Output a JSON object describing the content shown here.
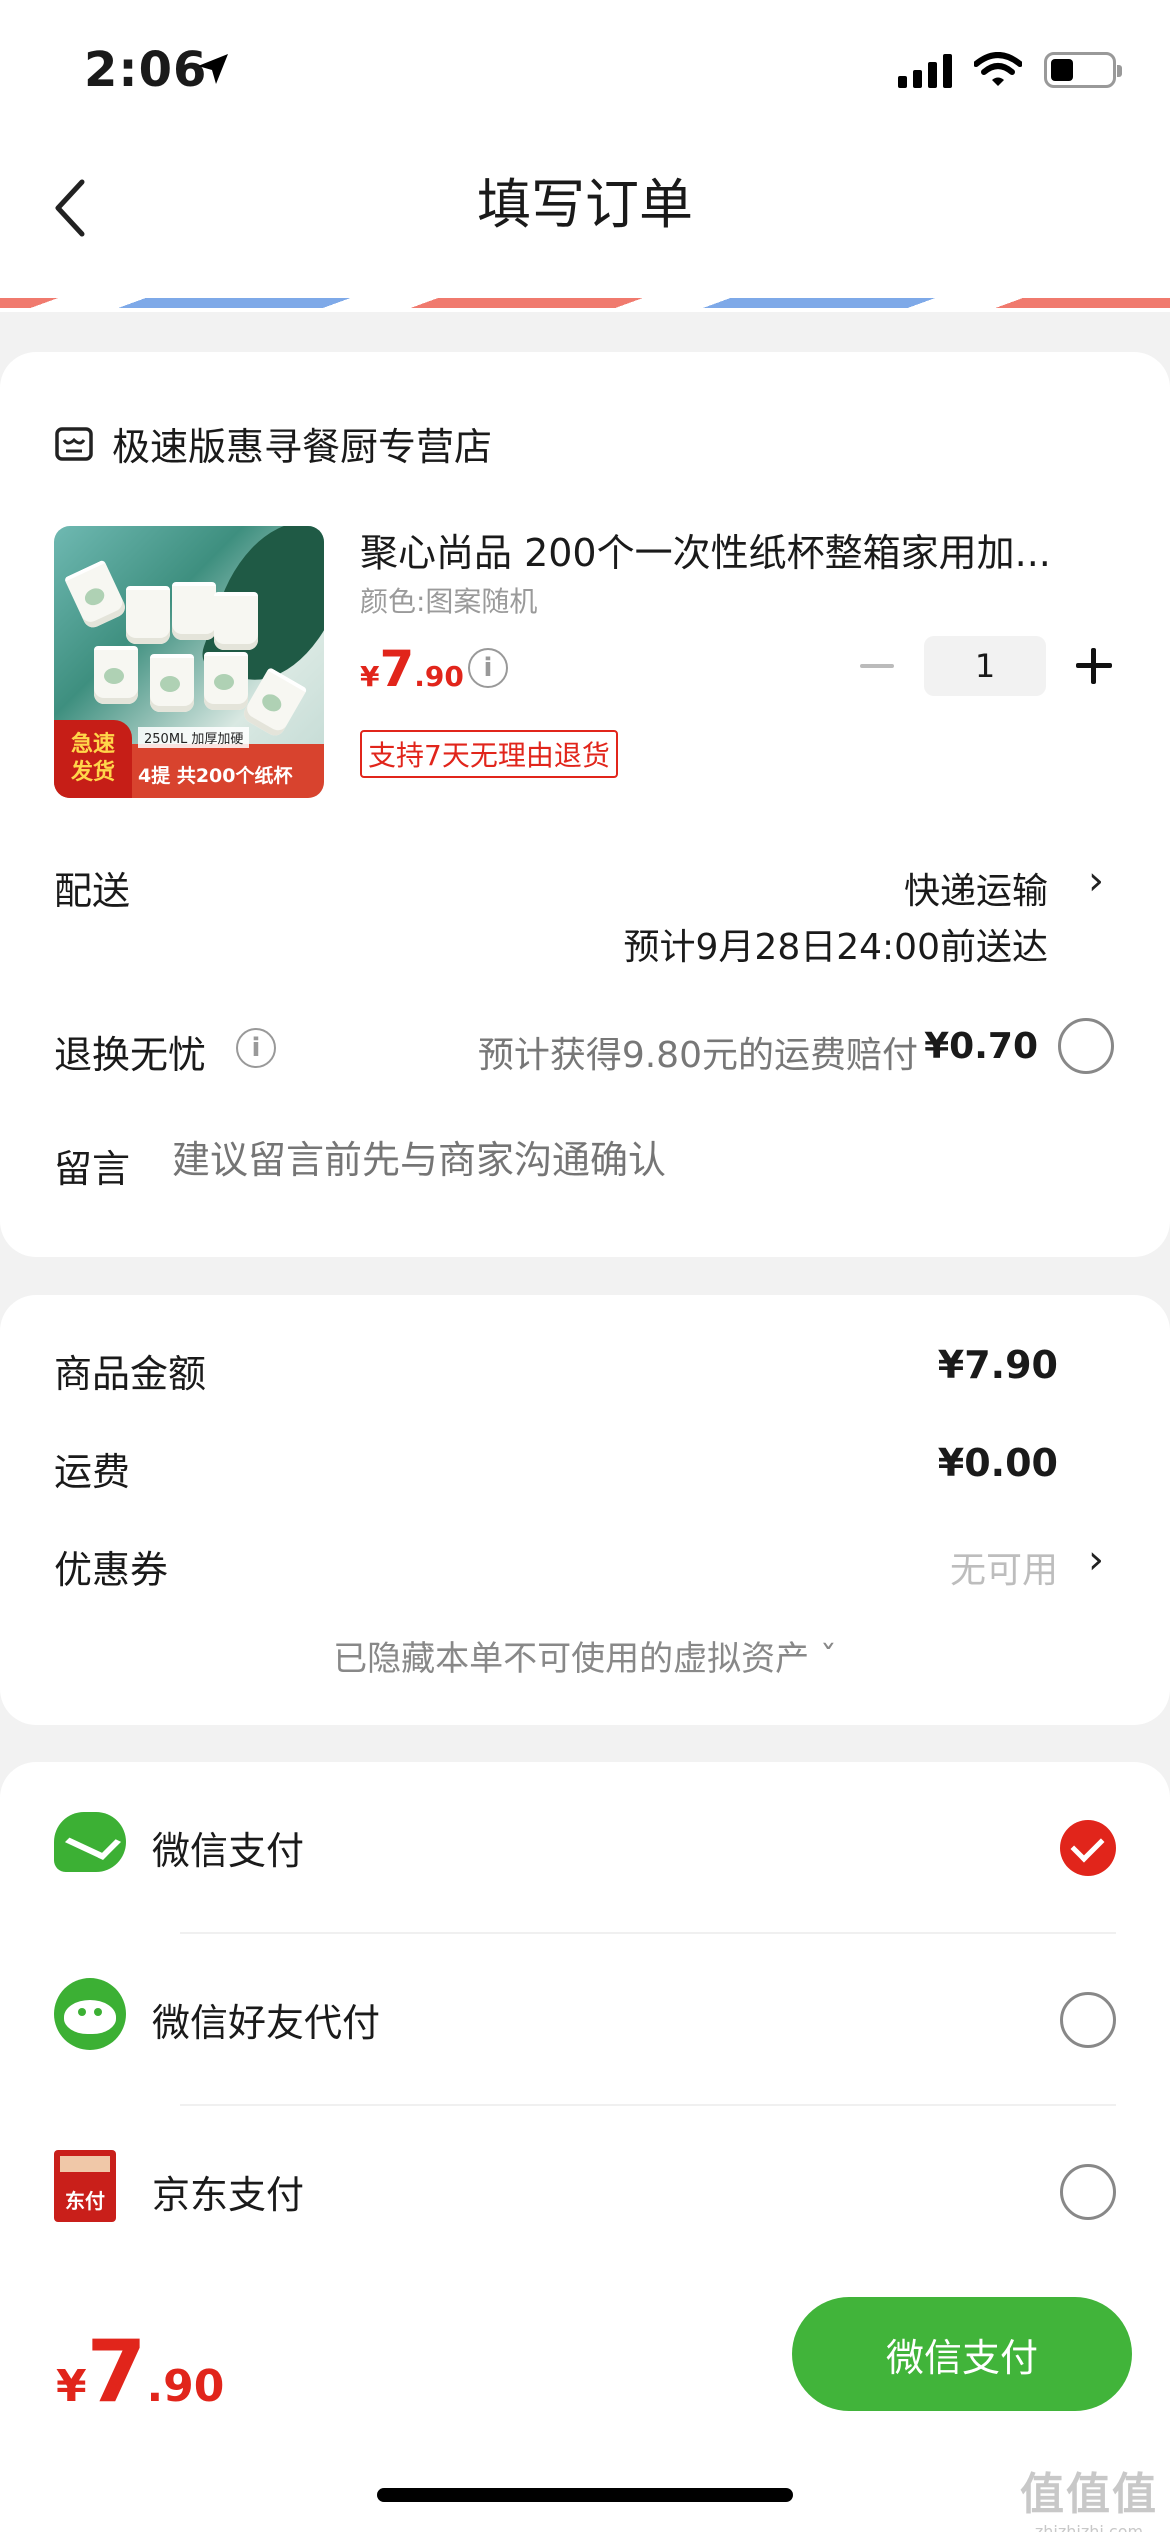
{
  "status_bar": {
    "time": "2:06"
  },
  "header": {
    "title": "填写订单"
  },
  "shop": {
    "name": "极速版惠寻餐厨专营店"
  },
  "product": {
    "title": "聚心尚品 200个一次性纸杯整箱家用加...",
    "variant": "颜色:图案随机",
    "price": {
      "currency": "¥",
      "integer": "7",
      "decimal": ".90"
    },
    "quantity": "1",
    "return_tag": "支持7天无理由退货",
    "image_badge_line1": "急速",
    "image_badge_line2": "发货",
    "image_caption_small": "250ML 加厚加硬",
    "image_caption": "4提 共200个纸杯"
  },
  "delivery": {
    "label": "配送",
    "method": "快递运输",
    "eta": "预计9月28日24:00前送达"
  },
  "return_insurance": {
    "label": "退换无忧",
    "desc": "预计获得9.80元的运费赔付",
    "price": "¥0.70"
  },
  "message": {
    "label": "留言",
    "placeholder": "建议留言前先与商家沟通确认"
  },
  "totals": {
    "goods_label": "商品金额",
    "goods_value": "¥7.90",
    "shipping_label": "运费",
    "shipping_value": "¥0.00",
    "coupon_label": "优惠券",
    "coupon_value": "无可用",
    "hidden_assets": "已隐藏本单不可使用的虚拟资产 ˇ"
  },
  "payment_methods": [
    {
      "label": "微信支付",
      "selected": true
    },
    {
      "label": "微信好友代付",
      "selected": false
    },
    {
      "label": "京东支付",
      "selected": false
    }
  ],
  "jd_icon_text": "东付",
  "footer": {
    "total": {
      "currency": "¥",
      "integer": "7",
      "decimal": ".90"
    },
    "pay_button": "微信支付"
  },
  "watermark": {
    "text": "值值值",
    "domain": "zhizhizhi.com"
  },
  "colors": {
    "accent_red": "#e1251b",
    "wechat_green": "#41b43a"
  }
}
